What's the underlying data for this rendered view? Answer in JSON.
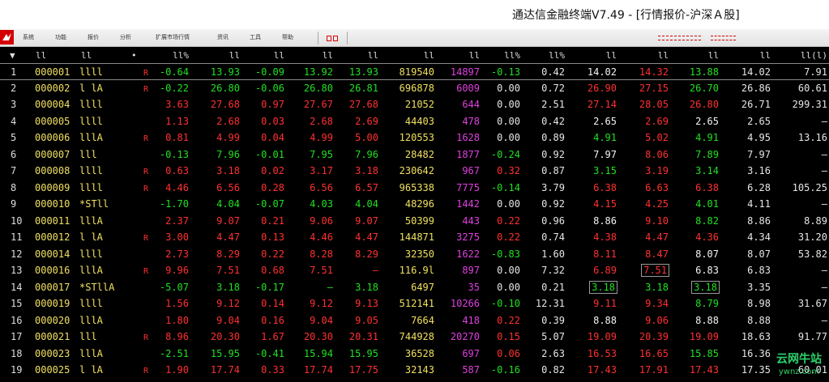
{
  "window": {
    "title": "通达信金融终端V7.49 - [行情报价-沪深Ａ股]"
  },
  "menubar": {
    "logo": "tdx-logo-icon",
    "items": [
      "系统",
      "功能",
      "报价",
      "分析",
      "扩展市场行情",
      "资讯",
      "工具",
      "帮助"
    ]
  },
  "header": {
    "cols": [
      "▼",
      "ll",
      "ll",
      "•",
      "ll%",
      "ll",
      "ll",
      "ll",
      "ll",
      "ll",
      "ll",
      "ll%",
      "ll%",
      "ll",
      "ll",
      "ll",
      "ll",
      "ll(l)"
    ]
  },
  "rows": [
    {
      "idx": "1",
      "code": "000001",
      "name": "llll",
      "r": "R",
      "c4": "-0.64",
      "c5": "13.93",
      "c6": "-0.09",
      "c7": "13.92",
      "c8": "13.93",
      "c9": "819540",
      "c10": "14897",
      "c11": "-0.13",
      "c12": "0.42",
      "c13": "14.02",
      "c14": "14.32",
      "c15": "13.88",
      "c16": "14.02",
      "c17": "7.91"
    },
    {
      "idx": "2",
      "code": "000002",
      "name": "l lA",
      "r": "R",
      "c4": "-0.22",
      "c5": "26.80",
      "c6": "-0.06",
      "c7": "26.80",
      "c8": "26.81",
      "c9": "696878",
      "c10": "6009",
      "c11": "0.00",
      "c12": "0.72",
      "c13": "26.90",
      "c14": "27.15",
      "c15": "26.70",
      "c16": "26.86",
      "c17": "60.61"
    },
    {
      "idx": "3",
      "code": "000004",
      "name": "llll",
      "r": "",
      "c4": "3.63",
      "c5": "27.68",
      "c6": "0.97",
      "c7": "27.67",
      "c8": "27.68",
      "c9": "21052",
      "c10": "644",
      "c11": "0.00",
      "c12": "2.51",
      "c13": "27.14",
      "c14": "28.05",
      "c15": "26.80",
      "c16": "26.71",
      "c17": "299.31"
    },
    {
      "idx": "4",
      "code": "000005",
      "name": "llll",
      "r": "",
      "c4": "1.13",
      "c5": "2.68",
      "c6": "0.03",
      "c7": "2.68",
      "c8": "2.69",
      "c9": "44403",
      "c10": "478",
      "c11": "0.00",
      "c12": "0.42",
      "c13": "2.65",
      "c14": "2.69",
      "c15": "2.65",
      "c16": "2.65",
      "c17": "–"
    },
    {
      "idx": "5",
      "code": "000006",
      "name": "lllA",
      "r": "R",
      "c4": "0.81",
      "c5": "4.99",
      "c6": "0.04",
      "c7": "4.99",
      "c8": "5.00",
      "c9": "120553",
      "c10": "1628",
      "c11": "0.00",
      "c12": "0.89",
      "c13": "4.91",
      "c14": "5.02",
      "c15": "4.91",
      "c16": "4.95",
      "c17": "13.16"
    },
    {
      "idx": "6",
      "code": "000007",
      "name": "lll",
      "r": "",
      "c4": "-0.13",
      "c5": "7.96",
      "c6": "-0.01",
      "c7": "7.95",
      "c8": "7.96",
      "c9": "28482",
      "c10": "1877",
      "c11": "-0.24",
      "c12": "0.92",
      "c13": "7.97",
      "c14": "8.06",
      "c15": "7.89",
      "c16": "7.97",
      "c17": "–"
    },
    {
      "idx": "7",
      "code": "000008",
      "name": "llll",
      "r": "R",
      "c4": "0.63",
      "c5": "3.18",
      "c6": "0.02",
      "c7": "3.17",
      "c8": "3.18",
      "c9": "230642",
      "c10": "967",
      "c11": "0.32",
      "c12": "0.87",
      "c13": "3.15",
      "c14": "3.19",
      "c15": "3.14",
      "c16": "3.16",
      "c17": "–"
    },
    {
      "idx": "8",
      "code": "000009",
      "name": "llll",
      "r": "R",
      "c4": "4.46",
      "c5": "6.56",
      "c6": "0.28",
      "c7": "6.56",
      "c8": "6.57",
      "c9": "965338",
      "c10": "7775",
      "c11": "-0.14",
      "c12": "3.79",
      "c13": "6.38",
      "c14": "6.63",
      "c15": "6.38",
      "c16": "6.28",
      "c17": "105.25"
    },
    {
      "idx": "9",
      "code": "000010",
      "name": "*STll",
      "r": "",
      "c4": "-1.70",
      "c5": "4.04",
      "c6": "-0.07",
      "c7": "4.03",
      "c8": "4.04",
      "c9": "48296",
      "c10": "1442",
      "c11": "0.00",
      "c12": "0.92",
      "c13": "4.15",
      "c14": "4.25",
      "c15": "4.01",
      "c16": "4.11",
      "c17": "–"
    },
    {
      "idx": "10",
      "code": "000011",
      "name": "lllA",
      "r": "",
      "c4": "2.37",
      "c5": "9.07",
      "c6": "0.21",
      "c7": "9.06",
      "c8": "9.07",
      "c9": "50399",
      "c10": "443",
      "c11": "0.22",
      "c12": "0.96",
      "c13": "8.86",
      "c14": "9.10",
      "c15": "8.82",
      "c16": "8.86",
      "c17": "8.89"
    },
    {
      "idx": "11",
      "code": "000012",
      "name": "l lA",
      "r": "R",
      "c4": "3.00",
      "c5": "4.47",
      "c6": "0.13",
      "c7": "4.46",
      "c8": "4.47",
      "c9": "144871",
      "c10": "3275",
      "c11": "0.22",
      "c12": "0.74",
      "c13": "4.38",
      "c14": "4.47",
      "c15": "4.36",
      "c16": "4.34",
      "c17": "31.20"
    },
    {
      "idx": "12",
      "code": "000014",
      "name": "llll",
      "r": "",
      "c4": "2.73",
      "c5": "8.29",
      "c6": "0.22",
      "c7": "8.28",
      "c8": "8.29",
      "c9": "32350",
      "c10": "1622",
      "c11": "-0.83",
      "c12": "1.60",
      "c13": "8.11",
      "c14": "8.47",
      "c15": "8.07",
      "c16": "8.07",
      "c17": "53.82"
    },
    {
      "idx": "13",
      "code": "000016",
      "name": "lllA",
      "r": "R",
      "c4": "9.96",
      "c5": "7.51",
      "c6": "0.68",
      "c7": "7.51",
      "c8": "–",
      "c9": "116.9l",
      "c10": "897",
      "c11": "0.00",
      "c12": "7.32",
      "c13": "6.89",
      "c14": "7.51",
      "c15": "6.83",
      "c16": "6.83",
      "c17": "–"
    },
    {
      "idx": "14",
      "code": "000017",
      "name": "*STllA",
      "r": "",
      "c4": "-5.07",
      "c5": "3.18",
      "c6": "-0.17",
      "c7": "–",
      "c8": "3.18",
      "c9": "6497",
      "c10": "35",
      "c11": "0.00",
      "c12": "0.21",
      "c13": "3.18",
      "c14": "3.18",
      "c15": "3.18",
      "c16": "3.35",
      "c17": "–"
    },
    {
      "idx": "15",
      "code": "000019",
      "name": "llll",
      "r": "",
      "c4": "1.56",
      "c5": "9.12",
      "c6": "0.14",
      "c7": "9.12",
      "c8": "9.13",
      "c9": "512141",
      "c10": "10266",
      "c11": "-0.10",
      "c12": "12.31",
      "c13": "9.11",
      "c14": "9.34",
      "c15": "8.79",
      "c16": "8.98",
      "c17": "31.67"
    },
    {
      "idx": "16",
      "code": "000020",
      "name": "lllA",
      "r": "",
      "c4": "1.80",
      "c5": "9.04",
      "c6": "0.16",
      "c7": "9.04",
      "c8": "9.05",
      "c9": "7664",
      "c10": "418",
      "c11": "0.22",
      "c12": "0.39",
      "c13": "8.88",
      "c14": "9.06",
      "c15": "8.88",
      "c16": "8.88",
      "c17": "–"
    },
    {
      "idx": "17",
      "code": "000021",
      "name": "lll",
      "r": "R",
      "c4": "8.96",
      "c5": "20.30",
      "c6": "1.67",
      "c7": "20.30",
      "c8": "20.31",
      "c9": "744928",
      "c10": "20270",
      "c11": "0.15",
      "c12": "5.07",
      "c13": "19.09",
      "c14": "20.39",
      "c15": "19.09",
      "c16": "18.63",
      "c17": "91.77"
    },
    {
      "idx": "18",
      "code": "000023",
      "name": "lllA",
      "r": "",
      "c4": "-2.51",
      "c5": "15.95",
      "c6": "-0.41",
      "c7": "15.94",
      "c8": "15.95",
      "c9": "36528",
      "c10": "697",
      "c11": "0.06",
      "c12": "2.63",
      "c13": "16.53",
      "c14": "16.65",
      "c15": "15.85",
      "c16": "16.36",
      "c17": ""
    },
    {
      "idx": "19",
      "code": "000025",
      "name": "l lA",
      "r": "R",
      "c4": "1.90",
      "c5": "17.74",
      "c6": "0.33",
      "c7": "17.74",
      "c8": "17.75",
      "c9": "32143",
      "c10": "587",
      "c11": "-0.16",
      "c12": "0.82",
      "c13": "17.43",
      "c14": "17.91",
      "c15": "17.43",
      "c16": "17.35",
      "c17": "60.01"
    }
  ],
  "watermark": {
    "line1": "云网牛站",
    "line2": "ywnz.com"
  },
  "colors": {
    "up": "#ff3030",
    "down": "#20e020",
    "flat": "#e6e6e6",
    "code": "#f0e060",
    "mag": "#e040e0"
  }
}
